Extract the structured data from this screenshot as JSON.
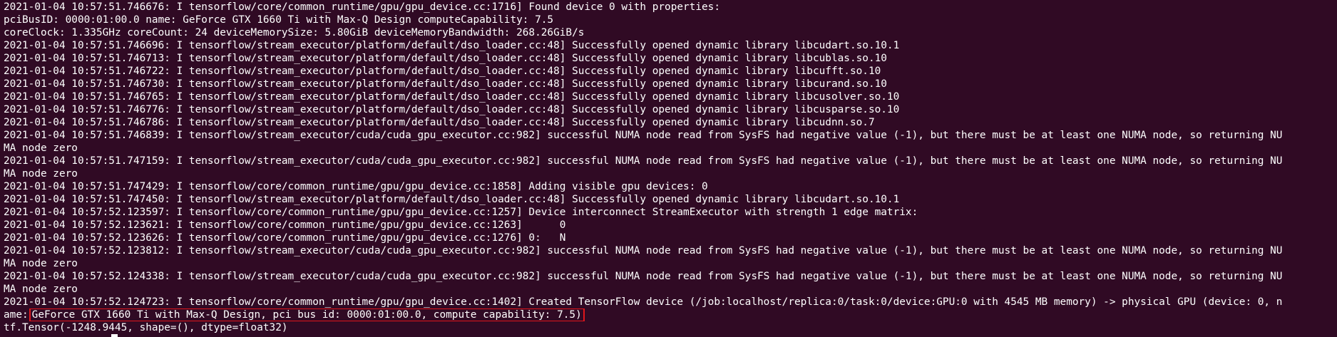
{
  "terminal": {
    "lines": [
      "2021-01-04 10:57:51.746676: I tensorflow/core/common_runtime/gpu/gpu_device.cc:1716] Found device 0 with properties:",
      "pciBusID: 0000:01:00.0 name: GeForce GTX 1660 Ti with Max-Q Design computeCapability: 7.5",
      "coreClock: 1.335GHz coreCount: 24 deviceMemorySize: 5.80GiB deviceMemoryBandwidth: 268.26GiB/s",
      "2021-01-04 10:57:51.746696: I tensorflow/stream_executor/platform/default/dso_loader.cc:48] Successfully opened dynamic library libcudart.so.10.1",
      "2021-01-04 10:57:51.746713: I tensorflow/stream_executor/platform/default/dso_loader.cc:48] Successfully opened dynamic library libcublas.so.10",
      "2021-01-04 10:57:51.746722: I tensorflow/stream_executor/platform/default/dso_loader.cc:48] Successfully opened dynamic library libcufft.so.10",
      "2021-01-04 10:57:51.746730: I tensorflow/stream_executor/platform/default/dso_loader.cc:48] Successfully opened dynamic library libcurand.so.10",
      "2021-01-04 10:57:51.746765: I tensorflow/stream_executor/platform/default/dso_loader.cc:48] Successfully opened dynamic library libcusolver.so.10",
      "2021-01-04 10:57:51.746776: I tensorflow/stream_executor/platform/default/dso_loader.cc:48] Successfully opened dynamic library libcusparse.so.10",
      "2021-01-04 10:57:51.746786: I tensorflow/stream_executor/platform/default/dso_loader.cc:48] Successfully opened dynamic library libcudnn.so.7",
      "2021-01-04 10:57:51.746839: I tensorflow/stream_executor/cuda/cuda_gpu_executor.cc:982] successful NUMA node read from SysFS had negative value (-1), but there must be at least one NUMA node, so returning NU",
      "MA node zero",
      "2021-01-04 10:57:51.747159: I tensorflow/stream_executor/cuda/cuda_gpu_executor.cc:982] successful NUMA node read from SysFS had negative value (-1), but there must be at least one NUMA node, so returning NU",
      "MA node zero",
      "2021-01-04 10:57:51.747429: I tensorflow/core/common_runtime/gpu/gpu_device.cc:1858] Adding visible gpu devices: 0",
      "2021-01-04 10:57:51.747450: I tensorflow/stream_executor/platform/default/dso_loader.cc:48] Successfully opened dynamic library libcudart.so.10.1",
      "2021-01-04 10:57:52.123597: I tensorflow/core/common_runtime/gpu/gpu_device.cc:1257] Device interconnect StreamExecutor with strength 1 edge matrix:",
      "2021-01-04 10:57:52.123621: I tensorflow/core/common_runtime/gpu/gpu_device.cc:1263]      0",
      "2021-01-04 10:57:52.123626: I tensorflow/core/common_runtime/gpu/gpu_device.cc:1276] 0:   N",
      "2021-01-04 10:57:52.123812: I tensorflow/stream_executor/cuda/cuda_gpu_executor.cc:982] successful NUMA node read from SysFS had negative value (-1), but there must be at least one NUMA node, so returning NU",
      "MA node zero",
      "2021-01-04 10:57:52.124338: I tensorflow/stream_executor/cuda/cuda_gpu_executor.cc:982] successful NUMA node read from SysFS had negative value (-1), but there must be at least one NUMA node, so returning NU",
      "MA node zero",
      "2021-01-04 10:57:52.124723: I tensorflow/core/common_runtime/gpu/gpu_device.cc:1402] Created TensorFlow device (/job:localhost/replica:0/task:0/device:GPU:0 with 4545 MB memory) -> physical GPU (device: 0, n"
    ],
    "highlight_prefix": "ame:",
    "highlight_text": "GeForce GTX 1660 Ti with Max-Q Design, pci bus id: 0000:01:00.0, compute capability: 7.5)",
    "last_line": "tf.Tensor(-1248.9445, shape=(), dtype=float32)",
    "colors": {
      "background": "#300a24",
      "text": "#ffffff",
      "highlight_border": "#e0161b"
    }
  }
}
